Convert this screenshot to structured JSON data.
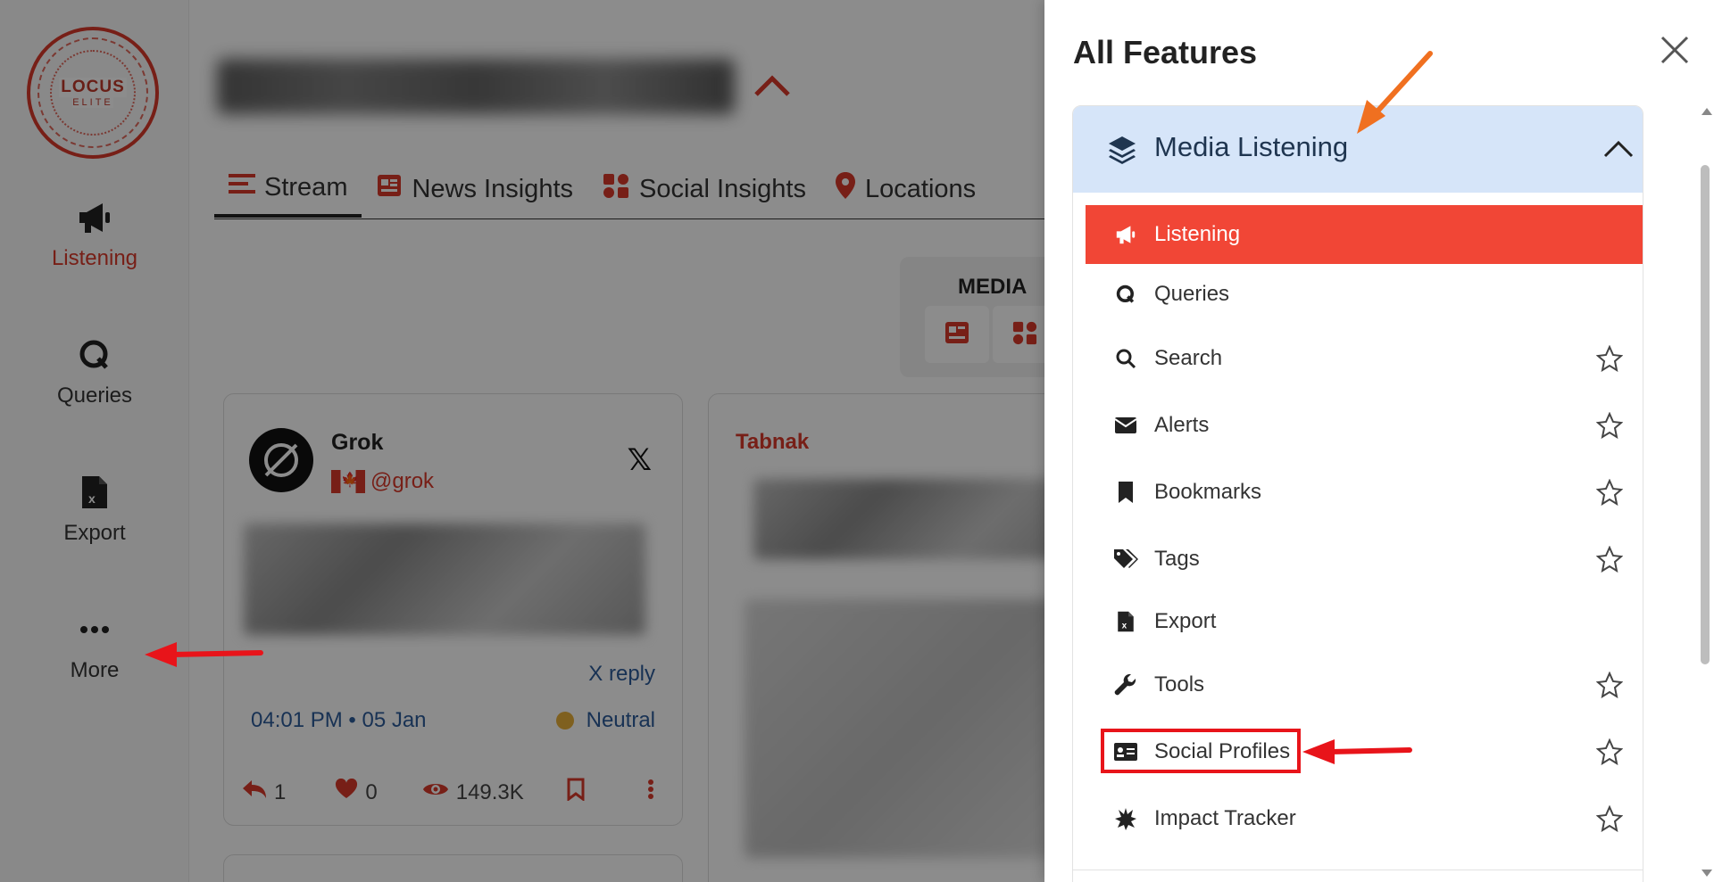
{
  "sidebar": {
    "logo": {
      "main": "LOCUS",
      "sub": "ELITE"
    },
    "items": [
      {
        "label": "Listening",
        "icon": "megaphone-icon"
      },
      {
        "label": "Queries",
        "icon": "query-icon"
      },
      {
        "label": "Export",
        "icon": "excel-file-icon"
      },
      {
        "label": "More",
        "icon": "more-dots-icon"
      }
    ]
  },
  "main": {
    "tabs": [
      {
        "label": "Stream",
        "icon": "list-icon"
      },
      {
        "label": "News Insights",
        "icon": "newspaper-icon"
      },
      {
        "label": "Social Insights",
        "icon": "social-icon"
      },
      {
        "label": "Locations",
        "icon": "map-pin-icon"
      }
    ],
    "media_panel": {
      "title": "MEDIA"
    },
    "post_card": {
      "name": "Grok",
      "handle": "@grok",
      "platform": "X",
      "link_label": "X reply",
      "timestamp": "04:01 PM • 05 Jan",
      "sentiment": "Neutral",
      "replies": "1",
      "likes": "0",
      "views": "149.3K"
    },
    "news_card": {
      "source": "Tabnak"
    }
  },
  "drawer": {
    "title": "All Features",
    "section": {
      "title": "Media Listening",
      "icon": "layers-icon"
    },
    "items": [
      {
        "label": "Listening",
        "icon": "megaphone-icon",
        "active": true,
        "star": false
      },
      {
        "label": "Queries",
        "icon": "query-icon",
        "active": false,
        "star": false
      },
      {
        "label": "Search",
        "icon": "search-icon",
        "active": false,
        "star": true
      },
      {
        "label": "Alerts",
        "icon": "envelope-icon",
        "active": false,
        "star": true
      },
      {
        "label": "Bookmarks",
        "icon": "bookmark-icon",
        "active": false,
        "star": true
      },
      {
        "label": "Tags",
        "icon": "tags-icon",
        "active": false,
        "star": true
      },
      {
        "label": "Export",
        "icon": "excel-file-icon",
        "active": false,
        "star": false
      },
      {
        "label": "Tools",
        "icon": "wrench-icon",
        "active": false,
        "star": true
      },
      {
        "label": "Social Profiles",
        "icon": "id-card-icon",
        "active": false,
        "star": true
      },
      {
        "label": "Impact Tracker",
        "icon": "burst-icon",
        "active": false,
        "star": true
      }
    ]
  },
  "colors": {
    "accent": "#d93a2b",
    "active_item": "#f14636",
    "section_header": "#d6e5f9",
    "annotation_red": "#e8141a",
    "annotation_orange": "#f07020"
  }
}
